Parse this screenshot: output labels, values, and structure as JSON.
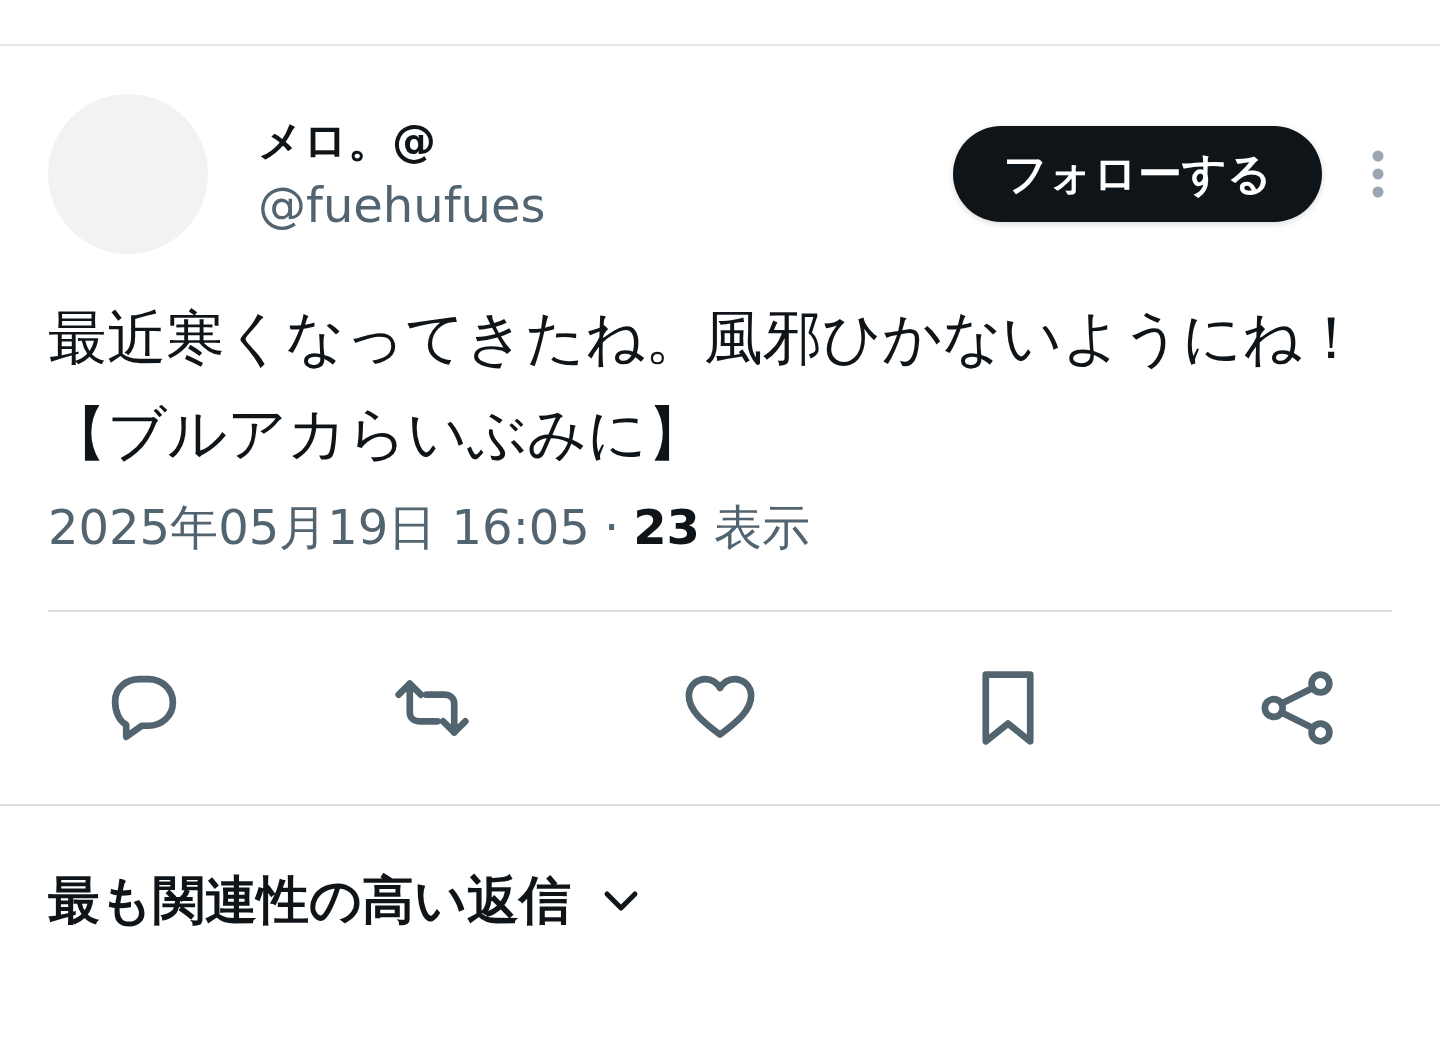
{
  "author": {
    "name": "メロ。@",
    "handle": "@fuehufues"
  },
  "follow_button": {
    "label": "フォローする"
  },
  "tweet": {
    "text": "最近寒くなってきたね。風邪ひかないようにね！【ブルアカらいぶみに】"
  },
  "meta": {
    "timestamp": "2025年05月19日 16:05",
    "separator": "·",
    "views_count": "23",
    "views_label": "表示"
  },
  "actions": [
    {
      "kind": "reply"
    },
    {
      "kind": "repost"
    },
    {
      "kind": "like"
    },
    {
      "kind": "bookmark"
    },
    {
      "kind": "share"
    }
  ],
  "replies_sort": {
    "label": "最も関連性の高い返信"
  }
}
